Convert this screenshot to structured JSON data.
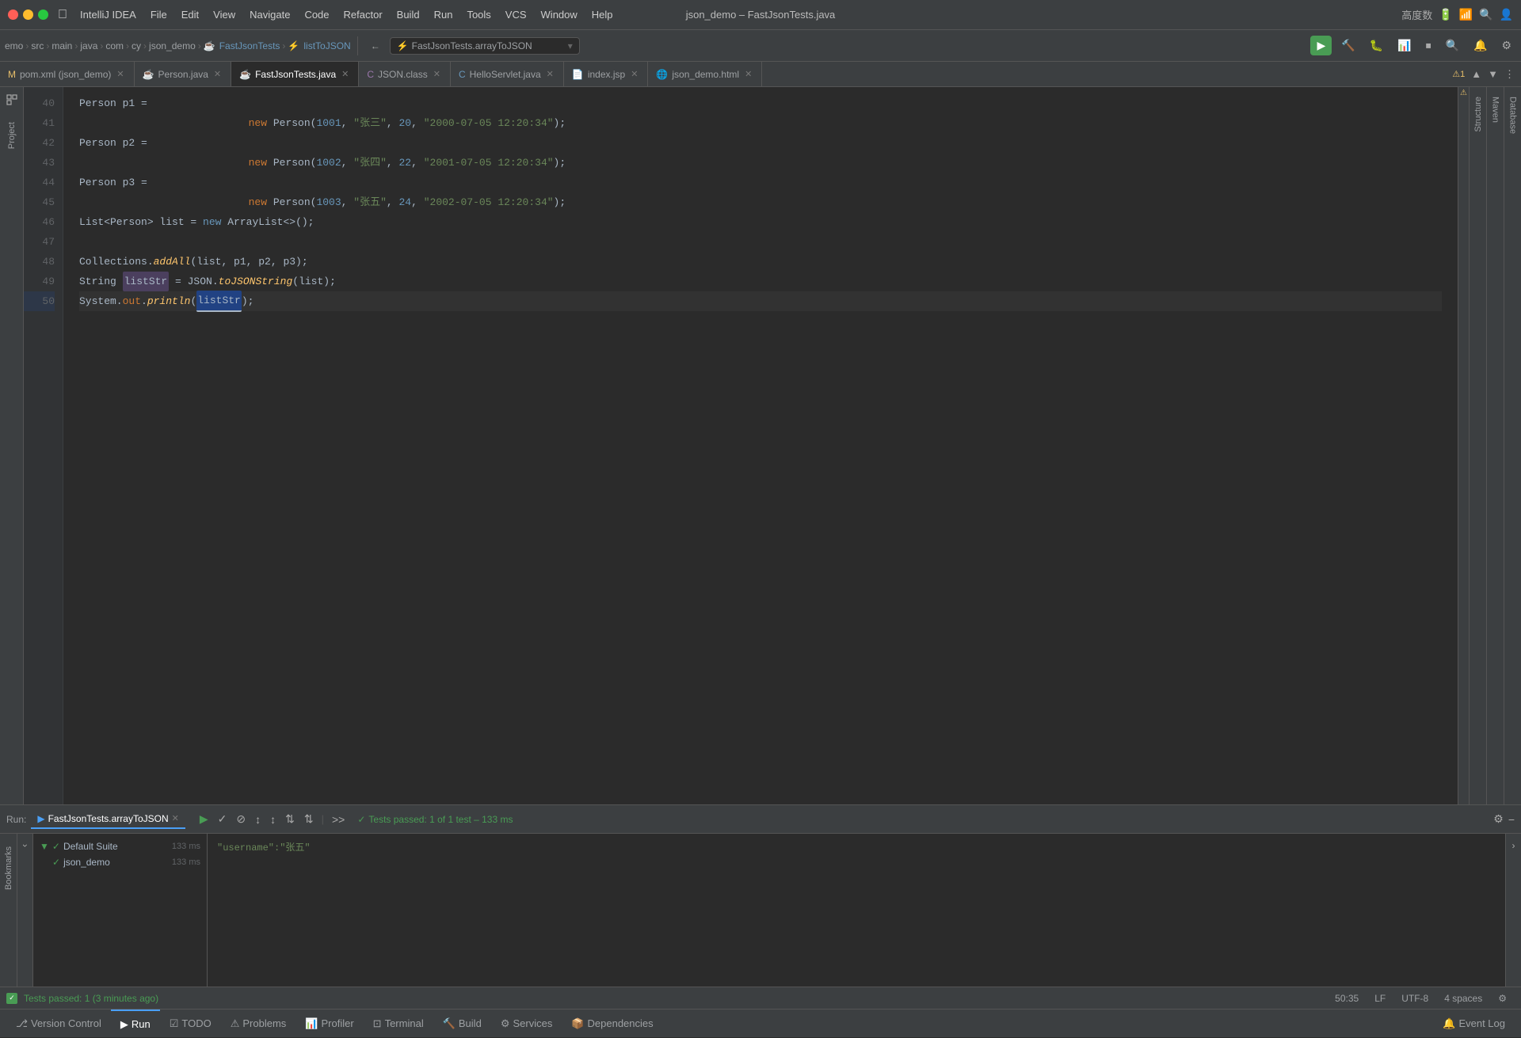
{
  "titlebar": {
    "title": "json_demo – FastJsonTests.java",
    "apple_icon": "",
    "menus": [
      "IntelliJ IDEA",
      "File",
      "Edit",
      "View",
      "Navigate",
      "Code",
      "Refactor",
      "Build",
      "Run",
      "Tools",
      "VCS",
      "Window",
      "Help"
    ],
    "chinese_chars": "高度数"
  },
  "toolbar": {
    "breadcrumbs": [
      "emo",
      "src",
      "main",
      "java",
      "com",
      "cy",
      "json_demo",
      "FastJsonTests",
      "listToJSON"
    ],
    "nav_method": "FastJsonTests.arrayToJSON",
    "run_btn": "▶",
    "build_btn": "🔨"
  },
  "tabs": [
    {
      "label": "pom.xml (json_demo)",
      "type": "xml",
      "icon": "M"
    },
    {
      "label": "Person.java",
      "type": "java"
    },
    {
      "label": "FastJsonTests.java",
      "type": "java",
      "active": true
    },
    {
      "label": "JSON.class",
      "type": "class"
    },
    {
      "label": "HelloServlet.java",
      "type": "java"
    },
    {
      "label": "index.jsp",
      "type": "jsp"
    },
    {
      "label": "json_demo.html",
      "type": "html"
    }
  ],
  "code_lines": [
    {
      "num": 40,
      "content": "Person p1 =",
      "tokens": [
        {
          "text": "Person ",
          "cls": "type"
        },
        {
          "text": "p1",
          "cls": "cn"
        },
        {
          "text": " =",
          "cls": "cn"
        }
      ]
    },
    {
      "num": 41,
      "content": "            new Person(1001, \"张三\", 20, \"2000-07-05 12:20:34\");",
      "tokens": [
        {
          "text": "        "
        },
        {
          "text": "new ",
          "cls": "kw"
        },
        {
          "text": "Person(",
          "cls": "cn"
        },
        {
          "text": "1001",
          "cls": "num"
        },
        {
          "text": ", ",
          "cls": "cn"
        },
        {
          "text": "\"张三\"",
          "cls": "str"
        },
        {
          "text": ", ",
          "cls": "cn"
        },
        {
          "text": "20",
          "cls": "num"
        },
        {
          "text": ", ",
          "cls": "cn"
        },
        {
          "text": "\"2000-07-05 12:20:34\"",
          "cls": "str"
        },
        {
          "text": ");",
          "cls": "cn"
        }
      ]
    },
    {
      "num": 42,
      "content": "Person p2 =",
      "tokens": [
        {
          "text": "Person ",
          "cls": "type"
        },
        {
          "text": "p2",
          "cls": "cn"
        },
        {
          "text": " =",
          "cls": "cn"
        }
      ]
    },
    {
      "num": 43,
      "content": "            new Person(1002, \"张四\", 22, \"2001-07-05 12:20:34\");",
      "tokens": [
        {
          "text": "        "
        },
        {
          "text": "new ",
          "cls": "kw"
        },
        {
          "text": "Person(",
          "cls": "cn"
        },
        {
          "text": "1002",
          "cls": "num"
        },
        {
          "text": ", ",
          "cls": "cn"
        },
        {
          "text": "\"张四\"",
          "cls": "str"
        },
        {
          "text": ", ",
          "cls": "cn"
        },
        {
          "text": "22",
          "cls": "num"
        },
        {
          "text": ", ",
          "cls": "cn"
        },
        {
          "text": "\"2001-07-05 12:20:34\"",
          "cls": "str"
        },
        {
          "text": ");",
          "cls": "cn"
        }
      ]
    },
    {
      "num": 44,
      "content": "Person p3 =",
      "tokens": [
        {
          "text": "Person ",
          "cls": "type"
        },
        {
          "text": "p3",
          "cls": "cn"
        },
        {
          "text": " =",
          "cls": "cn"
        }
      ]
    },
    {
      "num": 45,
      "content": "            new Person(1003, \"张五\", 24, \"2002-07-05 12:20:34\");",
      "tokens": [
        {
          "text": "        "
        },
        {
          "text": "new ",
          "cls": "kw"
        },
        {
          "text": "Person(",
          "cls": "cn"
        },
        {
          "text": "1003",
          "cls": "num"
        },
        {
          "text": ", ",
          "cls": "cn"
        },
        {
          "text": "\"张五\"",
          "cls": "str"
        },
        {
          "text": ", ",
          "cls": "cn"
        },
        {
          "text": "24",
          "cls": "num"
        },
        {
          "text": ", ",
          "cls": "cn"
        },
        {
          "text": "\"2002-07-05 12:20:34\"",
          "cls": "str"
        },
        {
          "text": ");",
          "cls": "cn"
        }
      ]
    },
    {
      "num": 46,
      "content": "List<Person> list = new ArrayList<>();",
      "tokens": [
        {
          "text": "List<Person> ",
          "cls": "type"
        },
        {
          "text": "list",
          "cls": "cn"
        },
        {
          "text": " = ",
          "cls": "cn"
        },
        {
          "text": "new ",
          "cls": "kw-blue"
        },
        {
          "text": "ArrayList",
          "cls": "cn"
        },
        {
          "text": "<>();",
          "cls": "cn"
        }
      ]
    },
    {
      "num": 47,
      "content": ""
    },
    {
      "num": 48,
      "content": "Collections.addAll(list, p1, p2, p3);",
      "tokens": [
        {
          "text": "Collections."
        },
        {
          "text": "addAll",
          "cls": "fn"
        },
        {
          "text": "(list, p1, p2, p3);",
          "cls": "cn"
        }
      ]
    },
    {
      "num": 49,
      "content": "String listStr = JSON.toJSONString(list);",
      "tokens": [
        {
          "text": "String "
        },
        {
          "text": "listStr",
          "cls": "var_highlight"
        },
        {
          "text": " = JSON."
        },
        {
          "text": "toJSONString",
          "cls": "fn"
        },
        {
          "text": "(list);",
          "cls": "cn"
        }
      ]
    },
    {
      "num": 50,
      "content": "System.out.println(listStr);",
      "tokens": [
        {
          "text": "System."
        },
        {
          "text": "out",
          "cls": "cn"
        },
        {
          "text": "."
        },
        {
          "text": "println",
          "cls": "fn"
        },
        {
          "text": "("
        },
        {
          "text": "listStr",
          "cls": "var_cursor"
        },
        {
          "text": ") ;",
          "cls": "cn"
        }
      ]
    }
  ],
  "run_panel": {
    "title": "Run:",
    "tab_label": "FastJsonTests.arrayToJSON",
    "test_passed_text": "Tests passed: 1 of 1 test – 133 ms",
    "suites": [
      {
        "label": "Default Suite",
        "time": "133 ms",
        "expanded": true
      },
      {
        "label": "json_demo",
        "time": "133 ms"
      }
    ],
    "output_lines": [
      "\"username\":\"张五\""
    ]
  },
  "run_statusbar": {
    "text": "Tests passed: 1 (3 minutes ago)"
  },
  "status_bar": {
    "position": "50:35",
    "encoding": "UTF-8",
    "line_sep": "LF",
    "indent": "4 spaces"
  },
  "bottom_bar": {
    "items": [
      {
        "label": "Version Control",
        "icon": "⎇"
      },
      {
        "label": "Run",
        "icon": "▶",
        "active": true
      },
      {
        "label": "TODO",
        "icon": "☑"
      },
      {
        "label": "Problems",
        "icon": "⚠"
      },
      {
        "label": "Profiler",
        "icon": "📊"
      },
      {
        "label": "Terminal",
        "icon": "⊡"
      },
      {
        "label": "Build",
        "icon": "🔨"
      },
      {
        "label": "Services",
        "icon": "⚙"
      },
      {
        "label": "Dependencies",
        "icon": "📦"
      }
    ],
    "right_items": [
      {
        "label": "Event Log",
        "icon": "🔔"
      }
    ]
  },
  "sidebar_labels": {
    "project": "Project",
    "structure": "Structure",
    "bookmarks": "Bookmarks",
    "maven": "Maven",
    "database": "Database"
  },
  "warning_count": "1"
}
